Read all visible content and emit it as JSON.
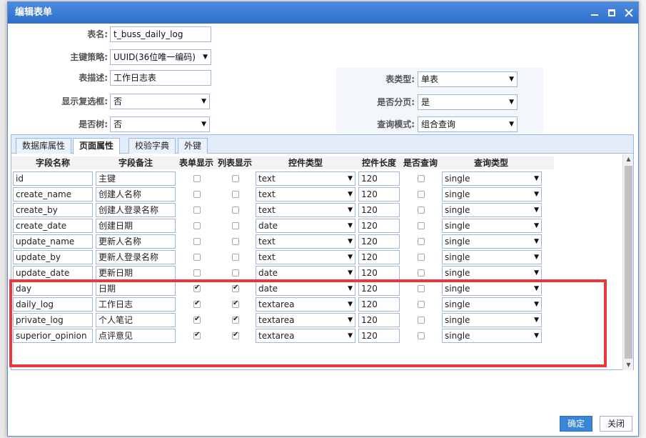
{
  "dialog": {
    "title": "编辑表单"
  },
  "form": {
    "table_name": {
      "label": "表名:",
      "value": "t_buss_daily_log"
    },
    "pk_strategy": {
      "label": "主键策略:",
      "value": "UUID(36位唯一编码)"
    },
    "table_desc": {
      "label": "表描述:",
      "value": "工作日志表"
    },
    "table_type": {
      "label": "表类型:",
      "value": "单表"
    },
    "show_checkbox": {
      "label": "显示复选框:",
      "value": "否"
    },
    "paging": {
      "label": "是否分页:",
      "value": "是"
    },
    "is_tree": {
      "label": "是否树:",
      "value": "否"
    },
    "query_mode": {
      "label": "查询模式:",
      "value": "组合查询"
    }
  },
  "tabs": [
    "数据库属性",
    "页面属性",
    "校验字典",
    "外键"
  ],
  "grid": {
    "headers": [
      "字段名称",
      "字段备注",
      "表单显示",
      "列表显示",
      "控件类型",
      "控件长度",
      "是否查询",
      "查询类型"
    ],
    "rows": [
      {
        "name": "id",
        "remark": "主键",
        "form": false,
        "list": false,
        "control": "text",
        "length": "120",
        "query": false,
        "qtype": "single"
      },
      {
        "name": "create_name",
        "remark": "创建人名称",
        "form": false,
        "list": false,
        "control": "text",
        "length": "120",
        "query": false,
        "qtype": "single"
      },
      {
        "name": "create_by",
        "remark": "创建人登录名称",
        "form": false,
        "list": false,
        "control": "text",
        "length": "120",
        "query": false,
        "qtype": "single"
      },
      {
        "name": "create_date",
        "remark": "创建日期",
        "form": false,
        "list": false,
        "control": "date",
        "length": "120",
        "query": false,
        "qtype": "single"
      },
      {
        "name": "update_name",
        "remark": "更新人名称",
        "form": false,
        "list": false,
        "control": "text",
        "length": "120",
        "query": false,
        "qtype": "single"
      },
      {
        "name": "update_by",
        "remark": "更新人登录名称",
        "form": false,
        "list": false,
        "control": "text",
        "length": "120",
        "query": false,
        "qtype": "single"
      },
      {
        "name": "update_date",
        "remark": "更新日期",
        "form": false,
        "list": false,
        "control": "date",
        "length": "120",
        "query": false,
        "qtype": "single"
      },
      {
        "name": "day",
        "remark": "日期",
        "form": true,
        "list": true,
        "control": "date",
        "length": "120",
        "query": false,
        "qtype": "single"
      },
      {
        "name": "daily_log",
        "remark": "工作日志",
        "form": true,
        "list": true,
        "control": "textarea",
        "length": "120",
        "query": false,
        "qtype": "single"
      },
      {
        "name": "private_log",
        "remark": "个人笔记",
        "form": true,
        "list": true,
        "control": "textarea",
        "length": "120",
        "query": false,
        "qtype": "single"
      },
      {
        "name": "superior_opinion",
        "remark": "点评意见",
        "form": true,
        "list": true,
        "control": "textarea",
        "length": "120",
        "query": false,
        "qtype": "single"
      }
    ]
  },
  "buttons": {
    "ok": "确定",
    "close": "关闭"
  },
  "colors": {
    "titlebar": "#2f6ec9",
    "highlight": "#e8383d",
    "ok_button": "#3a86d6"
  }
}
